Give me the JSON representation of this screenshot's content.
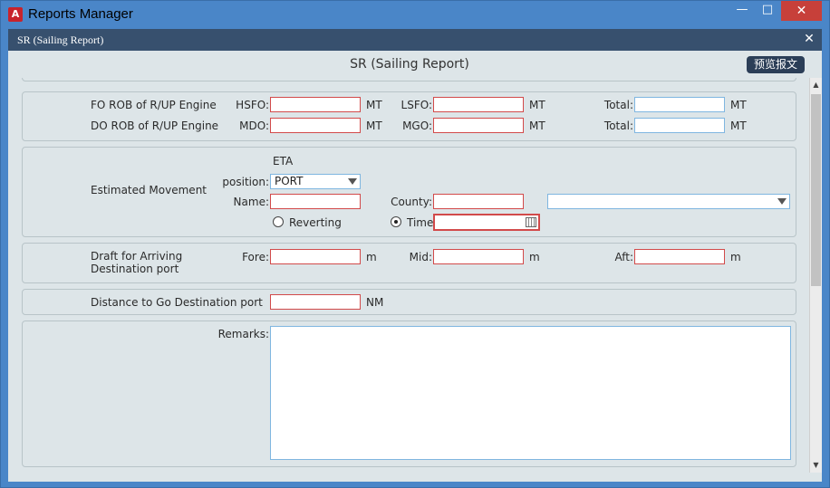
{
  "window": {
    "title": "Reports Manager",
    "app_icon": "app-logo-icon",
    "minimize": "—",
    "maximize": "□",
    "close": "✕"
  },
  "dialog": {
    "title": "SR (Sailing Report)",
    "close": "✕"
  },
  "report": {
    "title": "SR (Sailing Report)",
    "preview_button": "预览报文"
  },
  "fo_rob": {
    "label": "FO ROB of R/UP Engine",
    "hsfo_label": "HSFO:",
    "hsfo_value": "",
    "hsfo_unit": "MT",
    "lsfo_label": "LSFO:",
    "lsfo_value": "",
    "lsfo_unit": "MT",
    "total_label": "Total:",
    "total_value": "",
    "total_unit": "MT"
  },
  "do_rob": {
    "label": "DO ROB of R/UP Engine",
    "mdo_label": "MDO:",
    "mdo_value": "",
    "mdo_unit": "MT",
    "mgo_label": "MGO:",
    "mgo_value": "",
    "mgo_unit": "MT",
    "total_label": "Total:",
    "total_value": "",
    "total_unit": "MT"
  },
  "movement": {
    "label": "Estimated Movement",
    "eta_label": "ETA",
    "position_label": "position:",
    "position_value": "PORT",
    "name_label": "Name:",
    "name_value": "",
    "county_label": "County:",
    "county_value": "",
    "country_select_value": "",
    "reverting_label": "Reverting",
    "reverting_selected": false,
    "time_label": "Time:",
    "time_selected": true,
    "time_value": ""
  },
  "draft": {
    "label_line1": "Draft for Arriving",
    "label_line2": "Destination port",
    "fore_label": "Fore:",
    "fore_unit": "m",
    "mid_label": "Mid:",
    "mid_unit": "m",
    "aft_label": "Aft:",
    "aft_unit": "m"
  },
  "distance": {
    "label": "Distance to Go Destination port",
    "value": "",
    "unit": "NM"
  },
  "remarks": {
    "label": "Remarks:",
    "value": ""
  },
  "colors": {
    "titlebar": "#4a86c8",
    "dialog_header": "#37506e",
    "body": "#dde5e8",
    "field_error": "#d24a4a",
    "field_ok": "#7fb6e0"
  }
}
